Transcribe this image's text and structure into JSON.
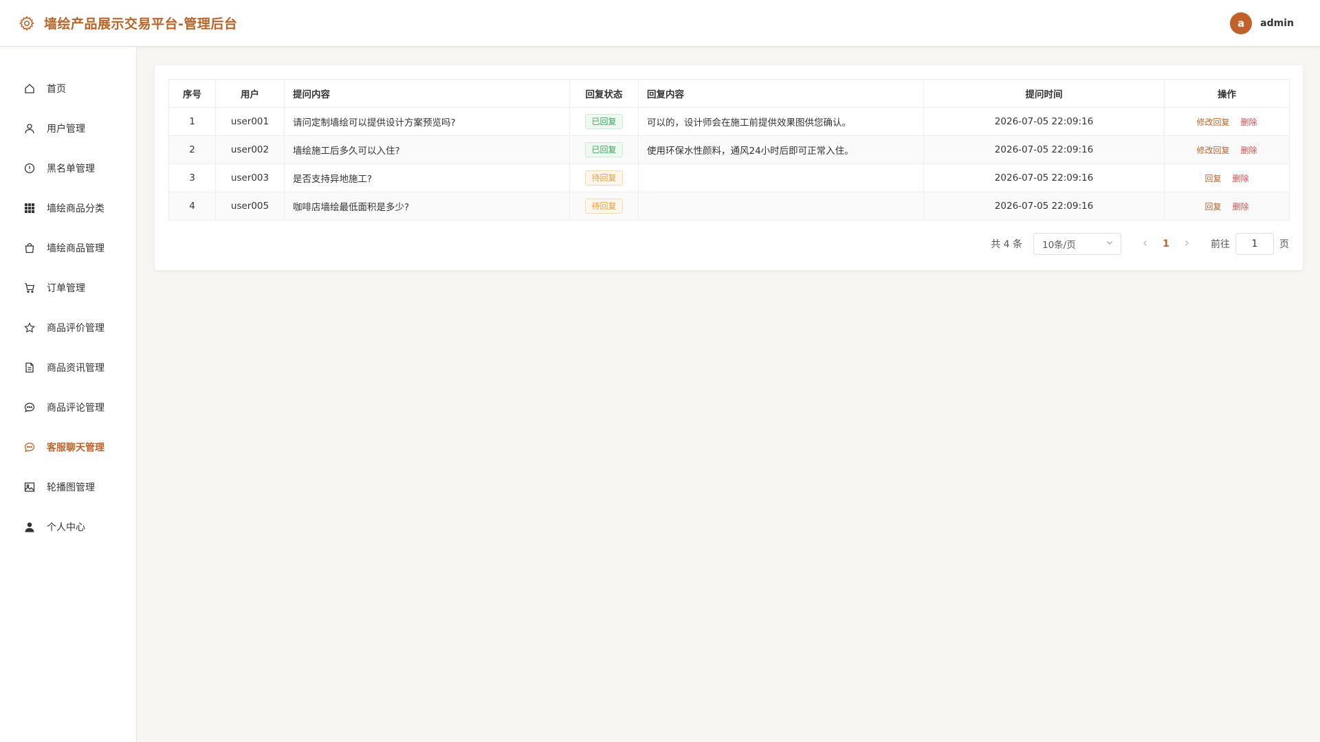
{
  "header": {
    "title": "墙绘产品展示交易平台-管理后台",
    "logo_icon": "gear-icon",
    "avatar_letter": "a",
    "username": "admin",
    "accent": "#c0622a"
  },
  "sidebar": {
    "items": [
      {
        "label": "首页",
        "icon": "home-icon"
      },
      {
        "label": "用户管理",
        "icon": "user-icon"
      },
      {
        "label": "黑名单管理",
        "icon": "alert-circle-icon"
      },
      {
        "label": "墙绘商品分类",
        "icon": "grid-icon"
      },
      {
        "label": "墙绘商品管理",
        "icon": "shopping-bag-icon"
      },
      {
        "label": "订单管理",
        "icon": "cart-icon"
      },
      {
        "label": "商品评价管理",
        "icon": "star-icon"
      },
      {
        "label": "商品资讯管理",
        "icon": "document-icon"
      },
      {
        "label": "商品评论管理",
        "icon": "comment-icon"
      },
      {
        "label": "客服聊天管理",
        "icon": "chat-icon",
        "active": true
      },
      {
        "label": "轮播图管理",
        "icon": "image-icon"
      },
      {
        "label": "个人中心",
        "icon": "person-icon"
      }
    ]
  },
  "table": {
    "columns": [
      "序号",
      "用户",
      "提问内容",
      "回复状态",
      "回复内容",
      "提问时间",
      "操作"
    ],
    "rows": [
      {
        "index": "1",
        "user": "user001",
        "question": "请问定制墙绘可以提供设计方案预览吗?",
        "status": "已回复",
        "status_type": "success",
        "reply": "可以的，设计师会在施工前提供效果图供您确认。",
        "time": "2026-07-05 22:09:16",
        "actions": [
          "修改回复",
          "删除"
        ]
      },
      {
        "index": "2",
        "user": "user002",
        "question": "墙绘施工后多久可以入住?",
        "status": "已回复",
        "status_type": "success",
        "reply": "使用环保水性颜料，通风24小时后即可正常入住。",
        "time": "2026-07-05 22:09:16",
        "actions": [
          "修改回复",
          "删除"
        ]
      },
      {
        "index": "3",
        "user": "user003",
        "question": "是否支持异地施工?",
        "status": "待回复",
        "status_type": "warning",
        "reply": "",
        "time": "2026-07-05 22:09:16",
        "actions": [
          "回复",
          "删除"
        ]
      },
      {
        "index": "4",
        "user": "user005",
        "question": "咖啡店墙绘最低面积是多少?",
        "status": "待回复",
        "status_type": "warning",
        "reply": "",
        "time": "2026-07-05 22:09:16",
        "actions": [
          "回复",
          "删除"
        ]
      }
    ]
  },
  "pagination": {
    "total_text": "共 4 条",
    "page_size": "10条/页",
    "current_page": "1",
    "goto_label": "前往",
    "goto_value": "1",
    "page_suffix": "页"
  }
}
